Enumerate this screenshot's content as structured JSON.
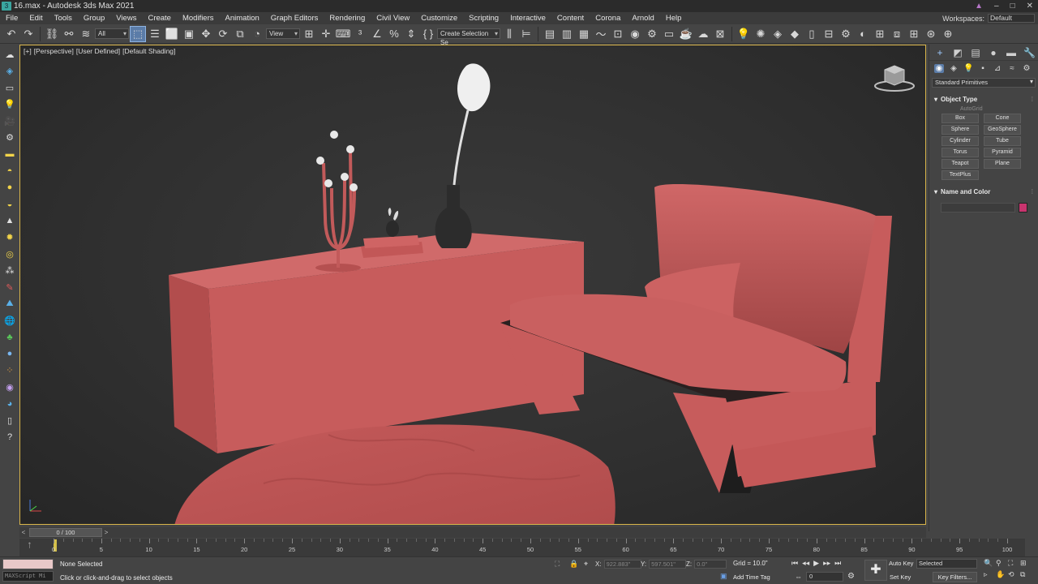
{
  "window": {
    "title": "16.max - Autodesk 3ds Max 2021",
    "controls": [
      "▲",
      "–",
      "□",
      "✕"
    ]
  },
  "menu": [
    "File",
    "Edit",
    "Tools",
    "Group",
    "Views",
    "Create",
    "Modifiers",
    "Animation",
    "Graph Editors",
    "Rendering",
    "Civil View",
    "Customize",
    "Scripting",
    "Interactive",
    "Content",
    "Corona",
    "Arnold",
    "Help"
  ],
  "workspace": {
    "label": "Workspaces:",
    "value": "Default"
  },
  "toolbar": {
    "filter_value": "All",
    "refcoord_value": "View",
    "selection_set_value": "Create Selection Se"
  },
  "viewport": {
    "label_plus": "[+]",
    "label_view": "[Perspective]",
    "label_user": "[User Defined]",
    "label_shading": "[Default Shading]"
  },
  "command_panel": {
    "category_value": "Standard Primitives",
    "object_type_title": "Object Type",
    "autogrid_label": "AutoGrid",
    "primitives": [
      "Box",
      "Cone",
      "Sphere",
      "GeoSphere",
      "Cylinder",
      "Tube",
      "Torus",
      "Pyramid",
      "Teapot",
      "Plane",
      "TextPlus"
    ],
    "name_color_title": "Name and Color",
    "object_color": "#c8346e"
  },
  "timeline": {
    "frame_display": "0 / 100",
    "ticks": [
      "0",
      "5",
      "10",
      "15",
      "20",
      "25",
      "30",
      "35",
      "40",
      "45",
      "50",
      "55",
      "60",
      "65",
      "70",
      "75",
      "80",
      "85",
      "90",
      "95",
      "100"
    ]
  },
  "status": {
    "maxscript_label": "MAXScript Mi",
    "selection_status": "None Selected",
    "prompt": "Click or click-and-drag to select objects",
    "x_label": "X:",
    "x_value": "922.883\"",
    "y_label": "Y:",
    "y_value": "597.501\"",
    "z_label": "Z:",
    "z_value": "0.0\"",
    "grid": "Grid = 10.0\"",
    "add_time_tag": "Add Time Tag",
    "current_frame": "0",
    "auto_key": "Auto Key",
    "set_key": "Set Key",
    "selected_dropdown": "Selected",
    "key_filters": "Key Filters..."
  },
  "colors": {
    "model_clay": "#c75c5c",
    "viewport_border": "#d9b54a",
    "active_button": "#5b7ca8"
  }
}
